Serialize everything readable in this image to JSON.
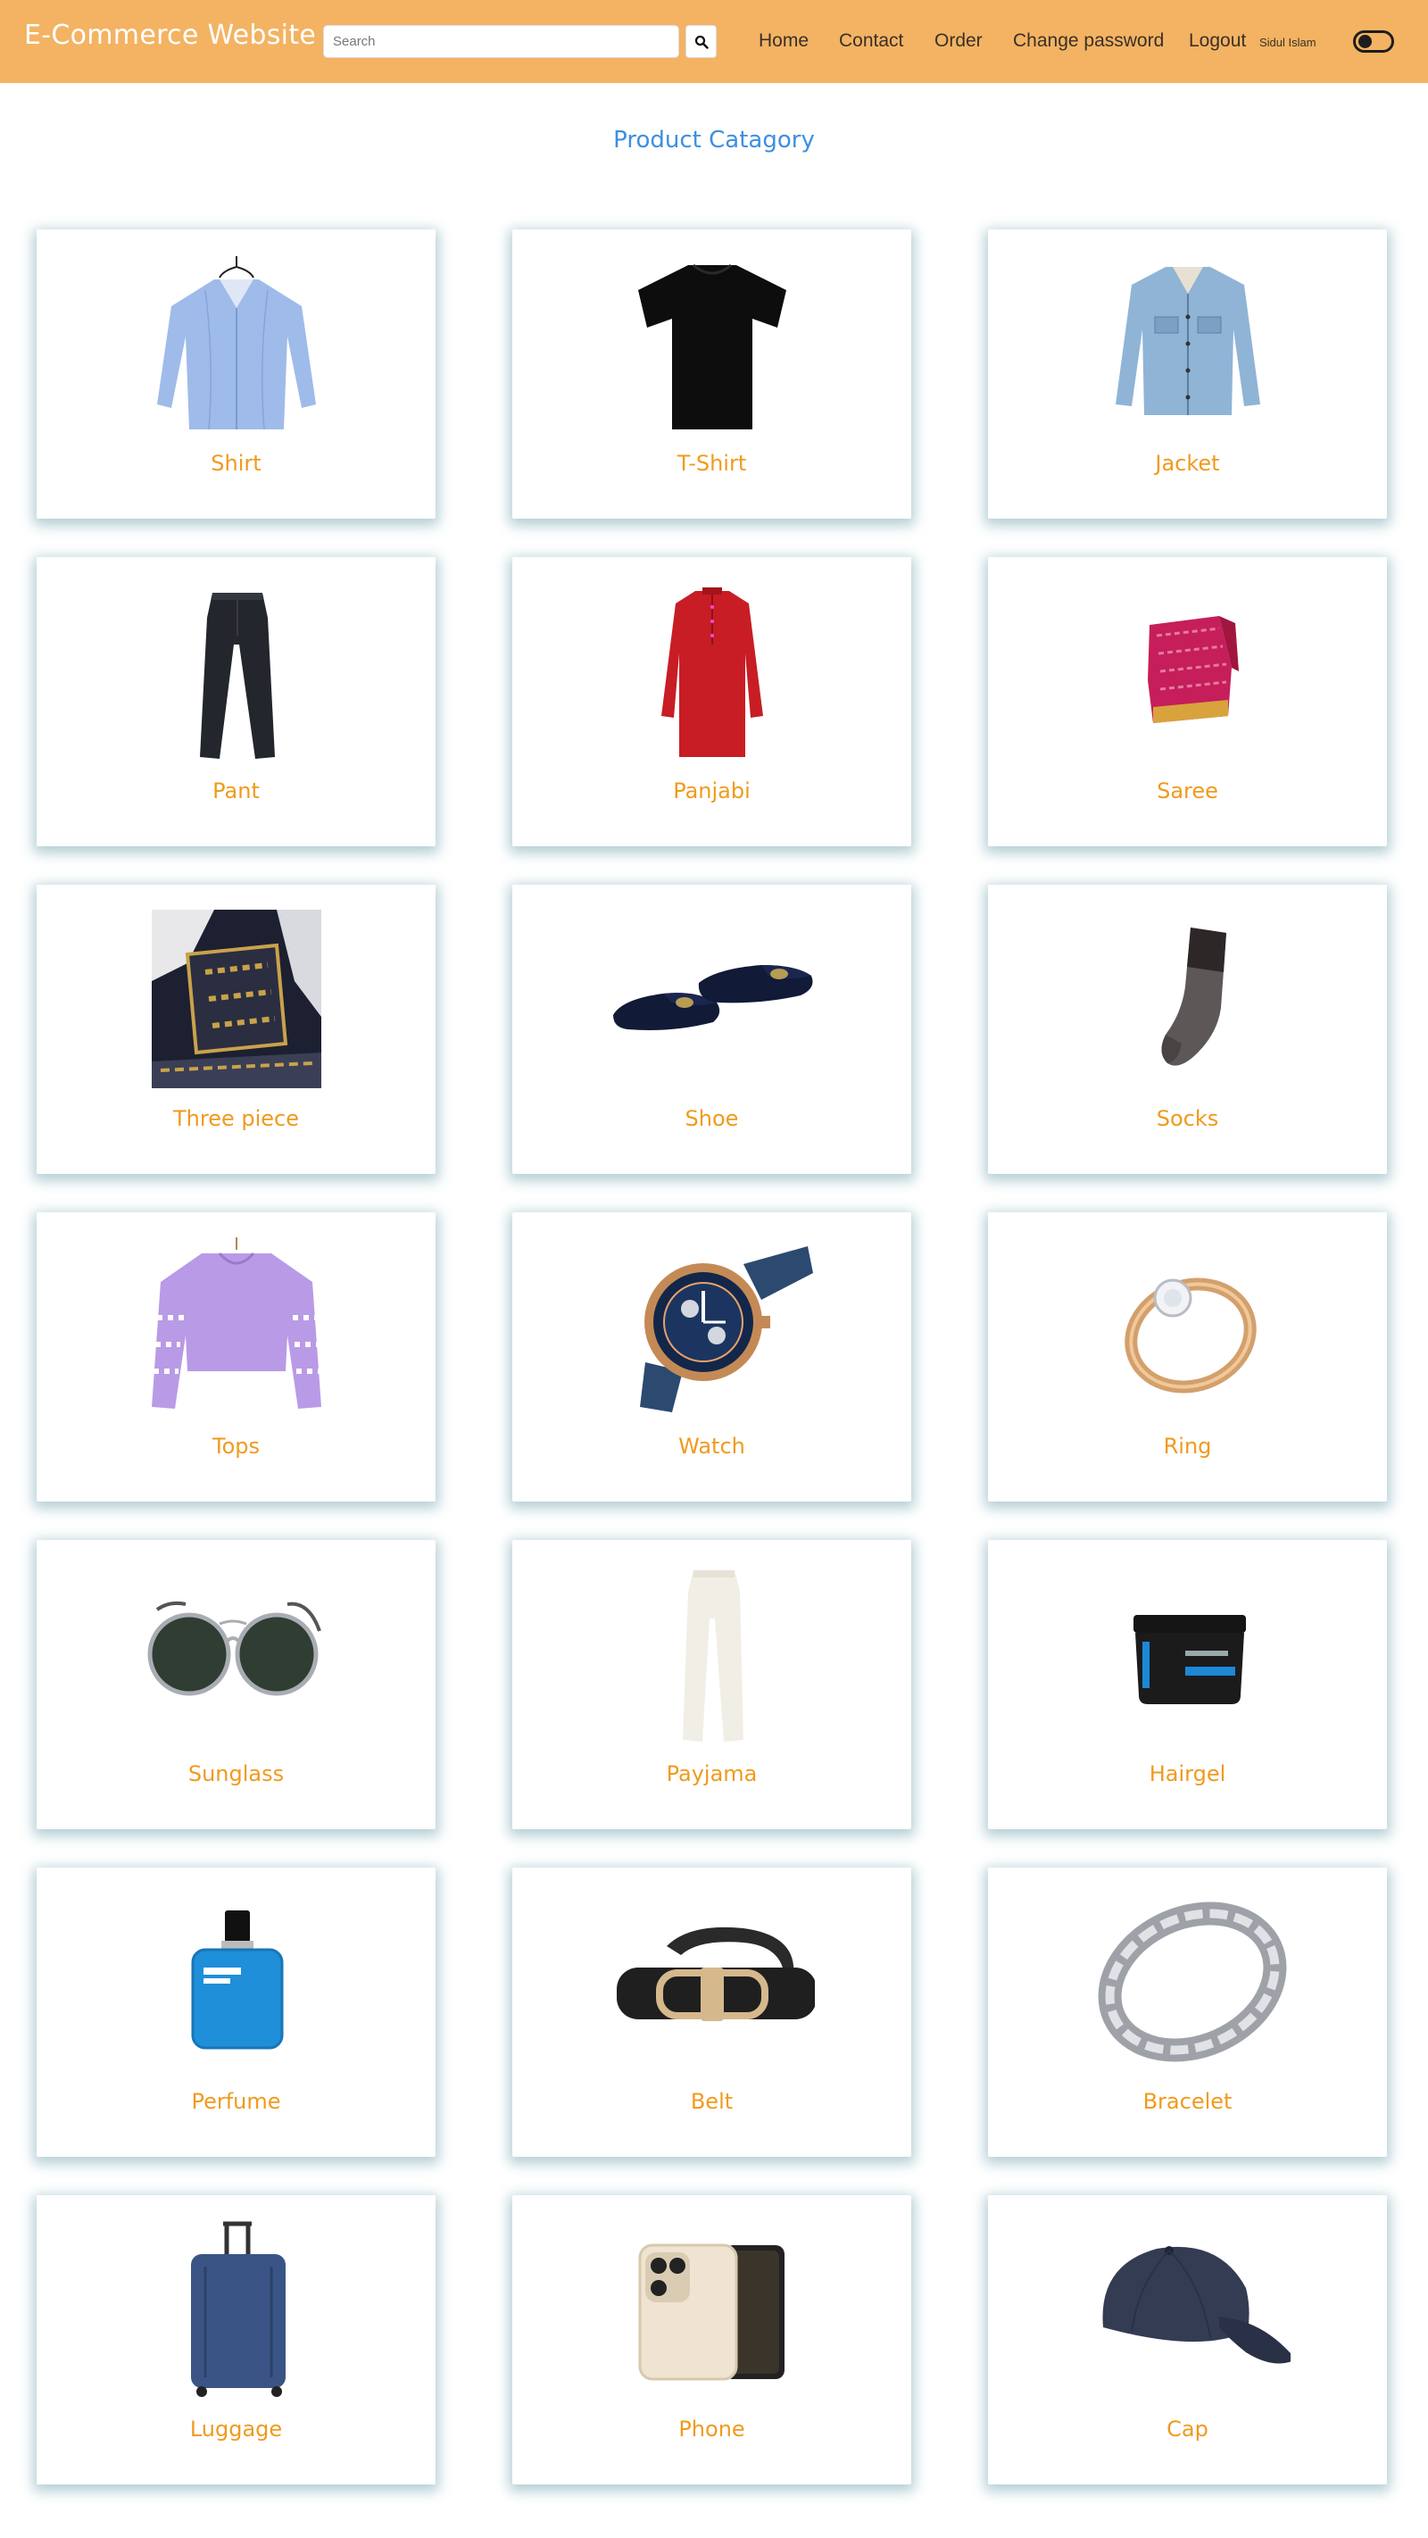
{
  "header": {
    "brand": "E-Commerce Website",
    "search_placeholder": "Search",
    "nav": {
      "home": "Home",
      "contact": "Contact",
      "order": "Order",
      "change_password": "Change password",
      "logout": "Logout"
    },
    "user_name": "Sidul Islam",
    "theme_toggle": "off"
  },
  "main": {
    "title": "Product Catagory",
    "categories": [
      {
        "label": "Shirt",
        "icon": "shirt"
      },
      {
        "label": "T-Shirt",
        "icon": "tshirt"
      },
      {
        "label": "Jacket",
        "icon": "jacket"
      },
      {
        "label": "Pant",
        "icon": "pant"
      },
      {
        "label": "Panjabi",
        "icon": "panjabi"
      },
      {
        "label": "Saree",
        "icon": "saree"
      },
      {
        "label": "Three piece",
        "icon": "three-piece"
      },
      {
        "label": "Shoe",
        "icon": "shoe"
      },
      {
        "label": "Socks",
        "icon": "socks"
      },
      {
        "label": "Tops",
        "icon": "tops"
      },
      {
        "label": "Watch",
        "icon": "watch"
      },
      {
        "label": "Ring",
        "icon": "ring"
      },
      {
        "label": "Sunglass",
        "icon": "sunglass"
      },
      {
        "label": "Payjama",
        "icon": "payjama"
      },
      {
        "label": "Hairgel",
        "icon": "hairgel"
      },
      {
        "label": "Perfume",
        "icon": "perfume"
      },
      {
        "label": "Belt",
        "icon": "belt"
      },
      {
        "label": "Bracelet",
        "icon": "bracelet"
      },
      {
        "label": "Luggage",
        "icon": "luggage"
      },
      {
        "label": "Phone",
        "icon": "phone"
      },
      {
        "label": "Cap",
        "icon": "cap"
      }
    ]
  },
  "colors": {
    "header_bg": "#f3b363",
    "title": "#3d8fe0",
    "label": "#f09a1d",
    "card_shadow": "#5a96a5"
  }
}
